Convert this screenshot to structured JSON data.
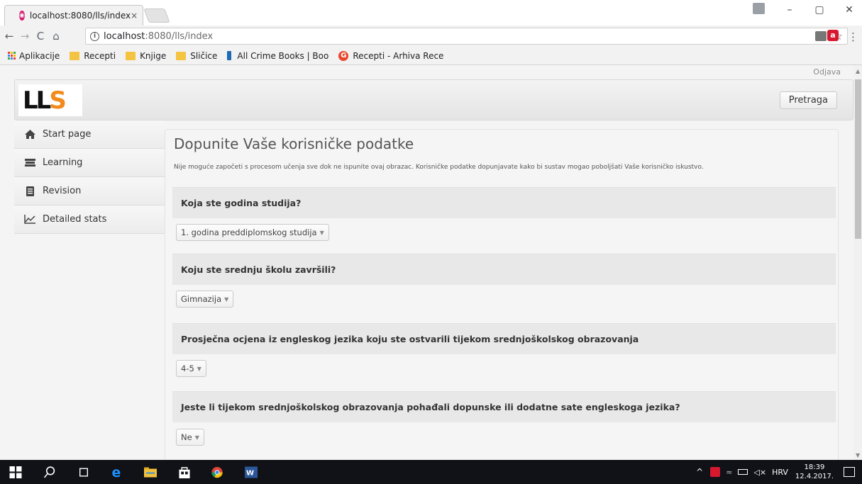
{
  "browser": {
    "tab_title": "localhost:8080/lls/index",
    "tab_close": "×",
    "url_host": "localhost",
    "url_path": ":8080/lls/index",
    "nav": {
      "back": "←",
      "forward": "→",
      "reload": "C",
      "home": "⌂"
    },
    "window": {
      "minimize": "–",
      "restore": "▢",
      "close": "✕"
    },
    "star": "☆",
    "menu": "⋮"
  },
  "bookmarks": [
    {
      "label": "Aplikacije",
      "icon": "apps-icon"
    },
    {
      "label": "Recepti",
      "icon": "folder-icon"
    },
    {
      "label": "Knjige",
      "icon": "folder-icon"
    },
    {
      "label": "Sličice",
      "icon": "folder-icon"
    },
    {
      "label": "All Crime Books | Boo",
      "icon": "book-icon"
    },
    {
      "label": "Recepti - Arhiva Rece",
      "icon": "recipe-site-icon"
    }
  ],
  "app": {
    "logout": "Odjava",
    "logo_text": "LLS",
    "search_button": "Pretraga",
    "sidebar": [
      {
        "label": "Start page",
        "icon": "home-icon"
      },
      {
        "label": "Learning",
        "icon": "books-icon"
      },
      {
        "label": "Revision",
        "icon": "notebook-icon"
      },
      {
        "label": "Detailed stats",
        "icon": "chart-icon"
      }
    ],
    "form": {
      "title": "Dopunite Vaše korisničke podatke",
      "intro": "Nije moguće započeti s procesom učenja sve dok ne ispunite ovaj obrazac. Korisničke podatke dopunjavate kako bi sustav mogao poboljšati Vaše korisničko iskustvo.",
      "questions": [
        {
          "label": "Koja ste godina studija?",
          "value": "1. godina preddiplomskog studija"
        },
        {
          "label": "Koju ste srednju školu završili?",
          "value": "Gimnazija"
        },
        {
          "label": "Prosječna ocjena iz engleskog jezika koju ste ostvarili tijekom srednjoškolskog obrazovanja",
          "value": "4-5"
        },
        {
          "label": "Jeste li tijekom srednjoškolskog obrazovanja pohađali dopunske ili dodatne sate engleskoga jezika?",
          "value": "Ne"
        }
      ]
    }
  },
  "taskbar": {
    "language": "HRV",
    "time": "18:39",
    "date": "12.4.2017."
  },
  "colors": {
    "accent_logo": "#f28a1c",
    "tab_favicon": "#d6196e",
    "taskbar": "#101217"
  }
}
